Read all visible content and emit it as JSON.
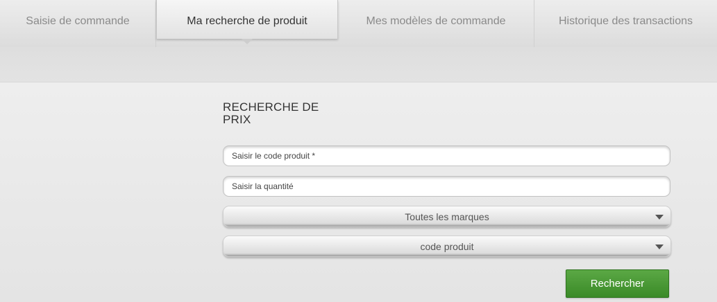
{
  "tabs": [
    {
      "label": "Saisie de commande"
    },
    {
      "label": "Ma recherche de produit",
      "active": true
    },
    {
      "label": "Mes modèles de commande"
    },
    {
      "label": "Historique des transactions"
    }
  ],
  "form": {
    "title_line1": "RECHERCHE DE",
    "title_line2": "PRIX",
    "product_code_placeholder": "Saisir le code produit *",
    "quantity_placeholder": "Saisir la quantité",
    "brand_select": "Toutes les marques",
    "search_by_select": "code produit",
    "search_button": "Rechercher"
  },
  "colors": {
    "accent_button": "#3f8f2b",
    "active_tab_text": "#333333",
    "inactive_tab_text": "#8a8a8a"
  },
  "icons": {
    "tab_pointer": "triangle-down",
    "select_caret": "caret-down-icon"
  }
}
